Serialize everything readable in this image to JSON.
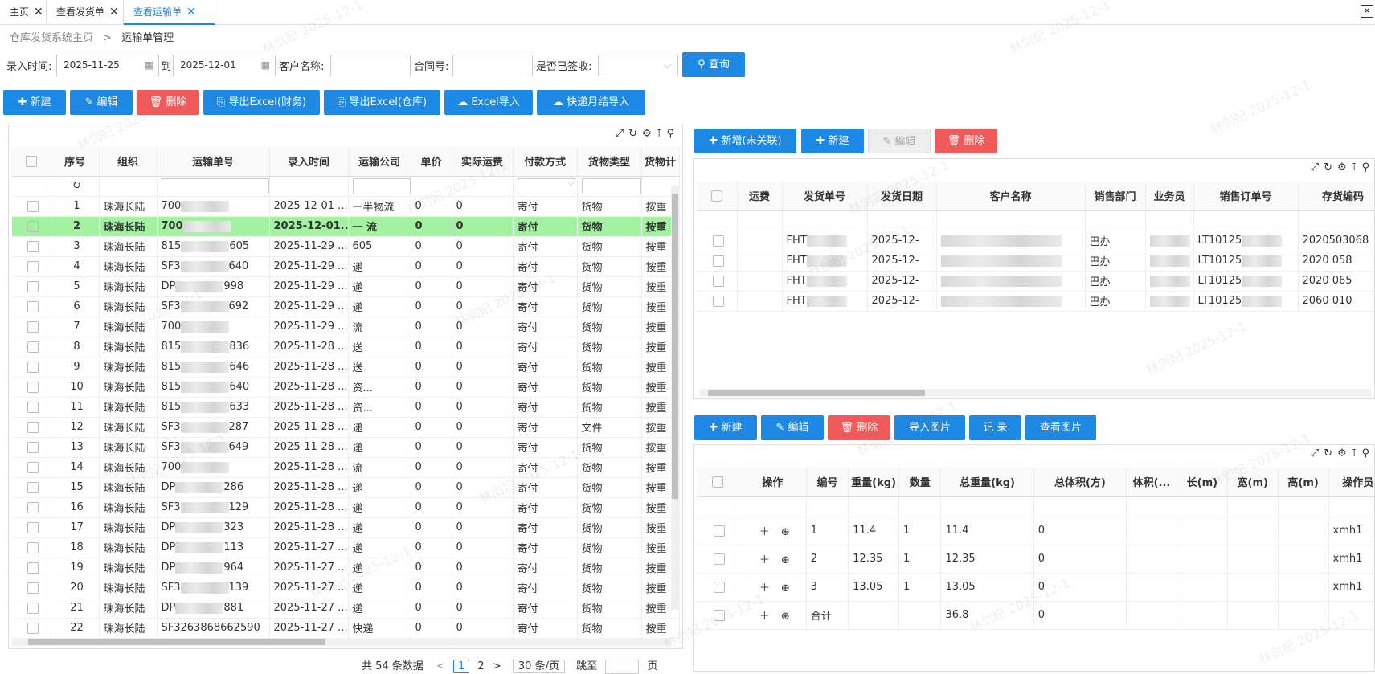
{
  "tabs": [
    {
      "label": "主页"
    },
    {
      "label": "查看发货单"
    },
    {
      "label": "查看运输单"
    }
  ],
  "tab_close": "✕",
  "breadcrumb": {
    "home": "仓库发货系统主页",
    "sep": ">",
    "current": "运输单管理"
  },
  "filters": {
    "entry_time_label": "录入时间:",
    "date_from": "2025-11-25",
    "to_label": "到",
    "date_to": "2025-12-01",
    "customer_label": "客户名称:",
    "contract_label": "合同号:",
    "signed_label": "是否已签收:",
    "query_btn": "查询"
  },
  "toolbar": {
    "new": "新建",
    "edit": "编辑",
    "delete": "删除",
    "export_fin": "导出Excel(财务)",
    "export_wh": "导出Excel(仓库)",
    "excel_import": "Excel导入",
    "express_import": "快递月结导入"
  },
  "main_table": {
    "headers": [
      "序号",
      "组织",
      "运输单号",
      "录入时间",
      "运输公司",
      "单价",
      "实际运费",
      "付款方式",
      "货物类型",
      "货物计"
    ],
    "rows": [
      [
        "1",
        "珠海长陆",
        "700",
        "2025-12-01 ...",
        "一半物流",
        "0",
        "0",
        "寄付",
        "货物",
        "按重"
      ],
      [
        "2",
        "珠海长陆",
        "700",
        "2025-12-01...",
        "一 流",
        "0",
        "0",
        "寄付",
        "货物",
        "按重"
      ],
      [
        "3",
        "珠海长陆",
        "815",
        "2025-11-29 ...",
        "605",
        "0",
        "0",
        "寄付",
        "货物",
        "按重"
      ],
      [
        "4",
        "珠海长陆",
        "SF3",
        "2025-11-29 ...",
        "递",
        "0",
        "0",
        "寄付",
        "货物",
        "按重"
      ],
      [
        "5",
        "珠海长陆",
        "DP",
        "2025-11-29 ...",
        "递",
        "0",
        "0",
        "寄付",
        "货物",
        "按重"
      ],
      [
        "6",
        "珠海长陆",
        "SF3",
        "2025-11-29 ...",
        "递",
        "0",
        "0",
        "寄付",
        "货物",
        "按重"
      ],
      [
        "7",
        "珠海长陆",
        "700",
        "2025-11-29 ...",
        "流",
        "0",
        "0",
        "寄付",
        "货物",
        "按重"
      ],
      [
        "8",
        "珠海长陆",
        "815",
        "2025-11-28 ...",
        "送",
        "0",
        "0",
        "寄付",
        "货物",
        "按重"
      ],
      [
        "9",
        "珠海长陆",
        "815",
        "2025-11-28 ...",
        "送",
        "0",
        "0",
        "寄付",
        "货物",
        "按重"
      ],
      [
        "10",
        "珠海长陆",
        "815",
        "2025-11-28 ...",
        "资...",
        "0",
        "0",
        "寄付",
        "货物",
        "按重"
      ],
      [
        "11",
        "珠海长陆",
        "815",
        "2025-11-28 ...",
        "资...",
        "0",
        "0",
        "寄付",
        "货物",
        "按重"
      ],
      [
        "12",
        "珠海长陆",
        "SF3",
        "2025-11-28 ...",
        "递",
        "0",
        "0",
        "寄付",
        "文件",
        "按重"
      ],
      [
        "13",
        "珠海长陆",
        "SF3",
        "2025-11-28 ...",
        "递",
        "0",
        "0",
        "寄付",
        "货物",
        "按重"
      ],
      [
        "14",
        "珠海长陆",
        "700",
        "2025-11-28 ...",
        "流",
        "0",
        "0",
        "寄付",
        "货物",
        "按重"
      ],
      [
        "15",
        "珠海长陆",
        "DP",
        "2025-11-28 ...",
        "递",
        "0",
        "0",
        "寄付",
        "货物",
        "按重"
      ],
      [
        "16",
        "珠海长陆",
        "SF3",
        "2025-11-28 ...",
        "递",
        "0",
        "0",
        "寄付",
        "货物",
        "按重"
      ],
      [
        "17",
        "珠海长陆",
        "DP",
        "2025-11-28 ...",
        "递",
        "0",
        "0",
        "寄付",
        "货物",
        "按重"
      ],
      [
        "18",
        "珠海长陆",
        "DP",
        "2025-11-27 ...",
        "递",
        "0",
        "0",
        "寄付",
        "货物",
        "按重"
      ],
      [
        "19",
        "珠海长陆",
        "DP",
        "2025-11-27 ...",
        "递",
        "0",
        "0",
        "寄付",
        "货物",
        "按重"
      ],
      [
        "20",
        "珠海长陆",
        "SF3",
        "2025-11-27 ...",
        "递",
        "0",
        "0",
        "寄付",
        "货物",
        "按重"
      ],
      [
        "21",
        "珠海长陆",
        "DP",
        "2025-11-27 ...",
        "递",
        "0",
        "0",
        "寄付",
        "货物",
        "按重"
      ],
      [
        "22",
        "珠海长陆",
        "SF3263868662590",
        "2025-11-27 ...",
        "快递",
        "0",
        "0",
        "寄付",
        "货物",
        "按重"
      ]
    ],
    "num_suffix": [
      "",
      "",
      "605",
      "640",
      "998",
      "692",
      "",
      "836",
      "646",
      "640",
      "633",
      "287",
      "649",
      "",
      "286",
      "129",
      "323",
      "113",
      "964",
      "139",
      "881",
      ""
    ]
  },
  "pager": {
    "total": "共 54 条数据",
    "prev": "<",
    "p1": "1",
    "p2": "2",
    "next": ">",
    "size": "30 条/页",
    "jump": "跳至",
    "page": "页"
  },
  "right_toolbar1": {
    "new_unlinked": "新增(未关联)",
    "new": "新建",
    "edit": "编辑",
    "delete": "删除"
  },
  "ship_table": {
    "headers": [
      "运费",
      "发货单号",
      "发货日期",
      "客户名称",
      "销售部门",
      "业务员",
      "销售订单号",
      "存货编码"
    ],
    "rows": [
      [
        "",
        "FHT",
        "2025-12-",
        "",
        "巴办",
        "",
        "LT10125",
        "2020503068"
      ],
      [
        "",
        "FHT",
        "2025-12-",
        "",
        "巴办",
        "",
        "LT10125",
        "2020 058"
      ],
      [
        "",
        "FHT",
        "2025-12-",
        "",
        "巴办",
        "",
        "LT10125",
        "2020 065"
      ],
      [
        "",
        "FHT",
        "2025-12-",
        "",
        "巴办",
        "",
        "LT10125",
        "2060 010"
      ]
    ]
  },
  "right_toolbar2": {
    "new": "新建",
    "edit": "编辑",
    "delete": "删除",
    "import_img": "导入图片",
    "record": "记 录",
    "view_img": "查看图片"
  },
  "pkg_table": {
    "headers": [
      "操作",
      "编号",
      "重量(kg)",
      "数量",
      "总重量(kg)",
      "总体积(方)",
      "体积(...",
      "长(m)",
      "宽(m)",
      "高(m)",
      "操作员"
    ],
    "rows": [
      [
        "1",
        "11.4",
        "1",
        "11.4",
        "0",
        "xmh1"
      ],
      [
        "2",
        "12.35",
        "1",
        "12.35",
        "0",
        "xmh1"
      ],
      [
        "3",
        "13.05",
        "1",
        "13.05",
        "0",
        "xmh1"
      ],
      [
        "合计",
        "",
        "",
        "36.8",
        "0",
        ""
      ]
    ]
  },
  "watermark": "林剑妃 2025-12-1"
}
